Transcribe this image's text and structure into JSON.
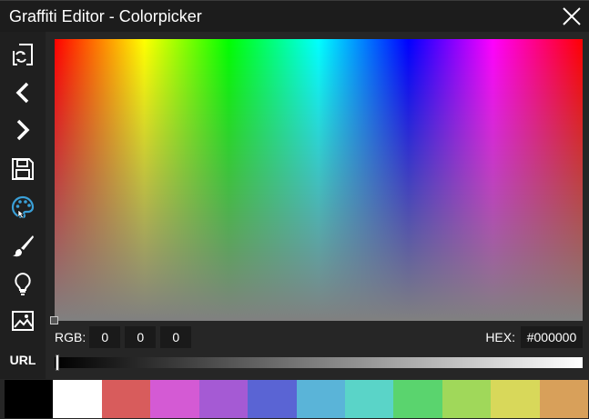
{
  "window": {
    "title": "Graffiti Editor - Colorpicker"
  },
  "toolbar": {
    "items": [
      {
        "name": "swap-canvas-icon"
      },
      {
        "name": "chevron-left-icon"
      },
      {
        "name": "chevron-right-icon"
      },
      {
        "name": "save-icon"
      },
      {
        "name": "palette-icon",
        "active": true
      },
      {
        "name": "brush-icon"
      },
      {
        "name": "lightbulb-icon"
      },
      {
        "name": "image-icon"
      },
      {
        "name": "url-button",
        "label": "URL"
      }
    ],
    "active_color": "#3aa0d8"
  },
  "color": {
    "rgb_label": "RGB:",
    "r": "0",
    "g": "0",
    "b": "0",
    "hex_label": "HEX:",
    "hex": "#000000",
    "brightness": 0
  },
  "palette": [
    "#000000",
    "#ffffff",
    "#d85c5c",
    "#d45ad4",
    "#a55ad4",
    "#5a64d4",
    "#5ab4d8",
    "#5ad4c8",
    "#5ad46e",
    "#a0d85a",
    "#d8d85a",
    "#d8a05a"
  ]
}
